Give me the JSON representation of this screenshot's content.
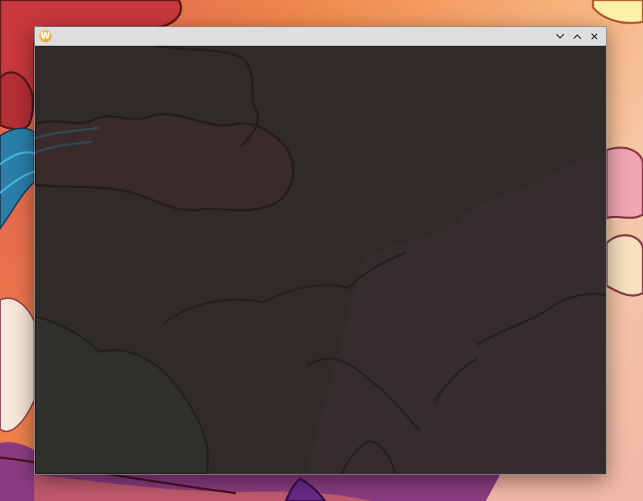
{
  "window": {
    "title": "",
    "app_icon_letter": "W",
    "app_icon_name": "app-logo-icon",
    "controls": {
      "minimize_icon": "chevron-down-icon",
      "maximize_icon": "chevron-up-icon",
      "close_icon": "close-icon"
    }
  },
  "colors": {
    "titlebar": "#dedede",
    "content_background": "#2e2b29",
    "wallpaper_primary": "#f08a4c"
  }
}
